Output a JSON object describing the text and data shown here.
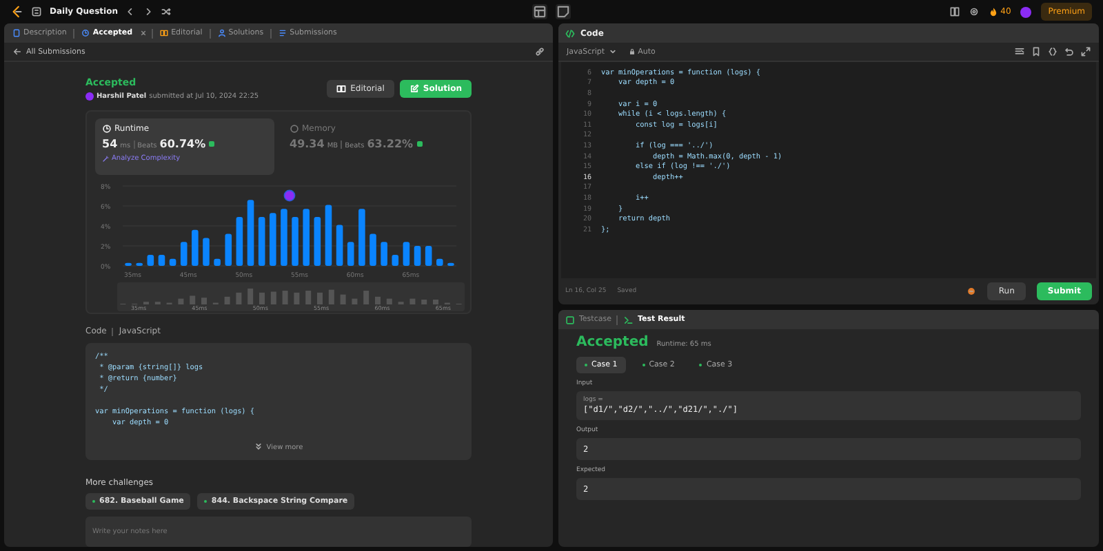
{
  "top_bar": {
    "title": "Daily Question",
    "streak": "40",
    "premium": "Premium"
  },
  "problem_tabs": [
    {
      "label": "Description",
      "selected": false,
      "closable": false
    },
    {
      "label": "Accepted",
      "selected": true,
      "closable": true
    },
    {
      "label": "Editorial",
      "selected": false,
      "closable": false
    },
    {
      "label": "Solutions",
      "selected": false,
      "closable": false
    },
    {
      "label": "Submissions",
      "selected": false,
      "closable": false
    }
  ],
  "back_link": "All Submissions",
  "submission": {
    "status": "Accepted",
    "author": "Harshil Patel",
    "submitted": "submitted at Jul 10, 2024 22:25",
    "buttons": [
      {
        "label": "Editorial",
        "kind": "secondary"
      },
      {
        "label": "Solution",
        "kind": "primary"
      }
    ]
  },
  "stats": [
    {
      "kind": "runtime",
      "title": "Runtime",
      "value": "54",
      "unit": "ms",
      "beats_label": "Beats",
      "beats": "60.74%",
      "selected": true,
      "link": "Analyze Complexity"
    },
    {
      "kind": "memory",
      "title": "Memory",
      "value": "49.34",
      "unit": "MB",
      "beats_label": "Beats",
      "beats": "63.22%",
      "selected": false
    }
  ],
  "chart_data": {
    "type": "bar",
    "categories": [
      "35ms",
      null,
      null,
      null,
      null,
      "45ms",
      null,
      null,
      null,
      null,
      "50ms",
      null,
      null,
      null,
      null,
      "55ms",
      null,
      null,
      null,
      null,
      "60ms",
      null,
      null,
      null,
      null,
      "65ms",
      null,
      null,
      null,
      null
    ],
    "series": [
      {
        "color": "#0a84ff",
        "values": [
          0.3,
          0.3,
          1.1,
          1.1,
          0.7,
          2.4,
          3.6,
          2.8,
          0.7,
          3.2,
          4.9,
          6.6,
          4.9,
          5.3,
          5.7,
          4.9,
          5.7,
          4.9,
          6.1,
          4.1,
          2.4,
          5.7,
          3.2,
          2.4,
          1.1,
          2.4,
          2.0,
          2.0,
          0.7,
          0.3
        ]
      }
    ],
    "ylim": [
      0,
      8
    ],
    "yticks": [
      {
        "value": 0,
        "label": "0%"
      },
      {
        "value": 2,
        "label": "2%"
      },
      {
        "value": 4,
        "label": "4%"
      },
      {
        "value": 6,
        "label": "6%"
      },
      {
        "value": 8,
        "label": "8%"
      }
    ],
    "grid": true
  },
  "navigator_labels": [
    "35ms",
    "45ms",
    "50ms",
    "55ms",
    "60ms",
    "65ms"
  ],
  "code_preview": {
    "label": "Code",
    "language": "JavaScript",
    "view_more": "View more",
    "lines": [
      [
        "/**",
        " * @param {string[]} logs",
        " * @return {number}",
        " */"
      ],
      [
        "var minOperations = function (logs) {",
        "    var depth = 0"
      ]
    ]
  },
  "more_challenges": {
    "title": "More challenges",
    "items": [
      "682. Baseball Game",
      "844. Backspace String Compare"
    ]
  },
  "notes": {
    "placeholder": "Write your notes here"
  },
  "editor": {
    "title": "Code",
    "language": "JavaScript",
    "mode": "Auto",
    "lines": [
      {
        "number": "6",
        "text": "var minOperations = function (logs) {",
        "current": false
      },
      {
        "number": "7",
        "text": "    var depth = 0",
        "current": false
      },
      {
        "number": "8",
        "current": false
      },
      {
        "number": "9",
        "text": "    var i = 0",
        "current": false
      },
      {
        "number": "10",
        "text": "    while (i < logs.length) {",
        "current": false
      },
      {
        "number": "11",
        "text": "        const log = logs[i]",
        "current": false
      },
      {
        "number": "12",
        "current": false
      },
      {
        "number": "13",
        "text": "        if (log === '../')",
        "current": false
      },
      {
        "number": "14",
        "text": "            depth = Math.max(0, depth - 1)",
        "current": false
      },
      {
        "number": "15",
        "text": "        else if (log !== './')",
        "current": false
      },
      {
        "number": "16",
        "text": "            depth++",
        "current": true
      },
      {
        "number": "17",
        "current": false
      },
      {
        "number": "18",
        "text": "        i++",
        "current": false
      },
      {
        "number": "19",
        "text": "    }",
        "current": false
      },
      {
        "number": "20",
        "text": "    return depth",
        "current": false
      },
      {
        "number": "21",
        "text": "};",
        "current": false
      }
    ],
    "position": "Ln 16, Col 25",
    "saved": "Saved",
    "actions": [
      {
        "label": "Run",
        "kind": "secondary"
      },
      {
        "label": "Submit",
        "kind": "primary"
      }
    ]
  },
  "result_tabs": [
    {
      "label": "Testcase",
      "selected": false
    },
    {
      "label": "Test Result",
      "selected": true
    }
  ],
  "result": {
    "status": "Accepted",
    "runtime": "Runtime: 65 ms",
    "cases": [
      {
        "label": "Case 1",
        "selected": true
      },
      {
        "label": "Case 2",
        "selected": false
      },
      {
        "label": "Case 3",
        "selected": false
      }
    ],
    "fields": [
      {
        "label": "Input",
        "name": "logs =",
        "value": "[\"d1/\",\"d2/\",\"../\",\"d21/\",\"./\"]"
      },
      {
        "label": "Output",
        "value": "2"
      },
      {
        "label": "Expected",
        "value": "2"
      }
    ]
  }
}
